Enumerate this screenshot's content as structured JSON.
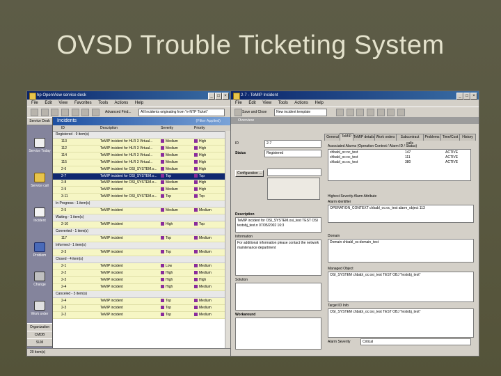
{
  "slide": {
    "title": "OVSD Trouble Ticketing System"
  },
  "left_window": {
    "title": "hp OpenView service desk",
    "menu": [
      "File",
      "Edit",
      "View",
      "Favorites",
      "Tools",
      "Actions",
      "Help"
    ],
    "advanced_find": "Advanced Find...",
    "query_combo": "All Incidents originating from \"e-NTP Ticket\"",
    "sidebar": [
      {
        "label": "Service Desk"
      },
      {
        "label": "Service Today"
      },
      {
        "label": "Service call"
      },
      {
        "label": "Incident"
      },
      {
        "label": "Problem"
      },
      {
        "label": "Change"
      },
      {
        "label": "Work order"
      }
    ],
    "sidebar_bottom": [
      "Organization",
      "CMDB",
      "SLM"
    ],
    "panel_title": "Incidents",
    "filter_label": "(Filter Applied)",
    "columns": [
      "ID",
      "Description",
      "Severity",
      "Priority"
    ],
    "rows": [
      {
        "kind": "group",
        "text": "Registered - 9 item(s)"
      },
      {
        "kind": "ticket",
        "id": "113",
        "desc": "TeMIP incident for HLR 3 Virtual...",
        "sev": "Medium",
        "pri": "High"
      },
      {
        "kind": "ticket",
        "id": "112",
        "desc": "TeMIP incident for HLR 3 Virtual...",
        "sev": "Medium",
        "pri": "High"
      },
      {
        "kind": "ticket",
        "id": "114",
        "desc": "TeMIP incident for HLR 3 Virtual...",
        "sev": "Medium",
        "pri": "High"
      },
      {
        "kind": "ticket",
        "id": "115",
        "desc": "TeMIP incident for HLR 3 Virtual...",
        "sev": "Medium",
        "pri": "High"
      },
      {
        "kind": "ticket",
        "id": "2-6",
        "desc": "TeMIP incident for OSI_SYSTEM.o...",
        "sev": "Medium",
        "pri": "High"
      },
      {
        "kind": "selected",
        "id": "2-7",
        "desc": "TeMIP incident for OSI_SYSTEM.o...",
        "sev": "Top",
        "pri": "Top"
      },
      {
        "kind": "ticket",
        "id": "2-8",
        "desc": "TeMIP incident for OSI_SYSTEM.o...",
        "sev": "Medium",
        "pri": "High"
      },
      {
        "kind": "ticket",
        "id": "2-9",
        "desc": "TeMIP incident",
        "sev": "Medium",
        "pri": "High"
      },
      {
        "kind": "ticket",
        "id": "3-11",
        "desc": "TeMIP incident for OSI_SYSTEM.o...",
        "sev": "Top",
        "pri": "Top"
      },
      {
        "kind": "group",
        "text": "In Progress - 1 item(s)"
      },
      {
        "kind": "ticket",
        "id": "2-5",
        "desc": "TeMIP incident",
        "sev": "Medium",
        "pri": "Medium"
      },
      {
        "kind": "group",
        "text": "Waiting - 1 item(s)"
      },
      {
        "kind": "ticket",
        "id": "2-10",
        "desc": "TeMIP incident",
        "sev": "High",
        "pri": "Top"
      },
      {
        "kind": "group",
        "text": "Converted - 1 item(s)"
      },
      {
        "kind": "ticket",
        "id": "117",
        "desc": "TeMIP incident",
        "sev": "Top",
        "pri": "Medium"
      },
      {
        "kind": "group",
        "text": "Informed - 1 item(s)"
      },
      {
        "kind": "ticket",
        "id": "2-3",
        "desc": "TeMIP incident",
        "sev": "Top",
        "pri": "Medium"
      },
      {
        "kind": "group",
        "text": "Closed - 4 item(s)"
      },
      {
        "kind": "ticket",
        "id": "2-1",
        "desc": "TeMIP incident",
        "sev": "Low",
        "pri": "Medium"
      },
      {
        "kind": "ticket",
        "id": "2-2",
        "desc": "TeMIP incident",
        "sev": "High",
        "pri": "Medium"
      },
      {
        "kind": "ticket",
        "id": "2-3",
        "desc": "TeMIP incident",
        "sev": "High",
        "pri": "High"
      },
      {
        "kind": "ticket",
        "id": "2-4",
        "desc": "TeMIP incident",
        "sev": "High",
        "pri": "Medium"
      },
      {
        "kind": "group",
        "text": "Canceled - 3 item(s)"
      },
      {
        "kind": "ticket",
        "id": "2-4",
        "desc": "TeMIP incident",
        "sev": "Top",
        "pri": "Medium"
      },
      {
        "kind": "ticket",
        "id": "2-3",
        "desc": "TeMIP incident",
        "sev": "Top",
        "pri": "Medium"
      },
      {
        "kind": "ticket",
        "id": "2-2",
        "desc": "TeMIP incident",
        "sev": "Top",
        "pri": "Medium"
      }
    ],
    "status": "20 item(s)"
  },
  "right_window": {
    "title": "2-7 - TeMIP Incident",
    "menu": [
      "File",
      "Edit",
      "View",
      "Tools",
      "Actions",
      "Help"
    ],
    "save_close": "Save and Close",
    "template_combo": "New incident template",
    "overview": "Overview",
    "id_label": "ID",
    "id_value": "2-7",
    "status_label": "Status",
    "status_value": "Registered",
    "configuration_button": "Configuration ...",
    "description_label": "Description",
    "description_value": "TeMIP incident for OSI_SYSTEM.osi_test TEST OSI testobj_test.n 07/05/2002 16:3",
    "information_label": "Information",
    "information_value": "For additional information please contact the network maintenance department",
    "solution_label": "Solution",
    "workaround_label": "Workaround",
    "tabs": [
      "General",
      "TeMIP",
      "TeMIP details",
      "Work orders",
      "Subcontract calls",
      "Problems",
      "Time/Cost",
      "History"
    ],
    "alarms_label": "Associated Alarms (Operation Context / Alarm ID / Status)",
    "alarms": [
      {
        "ctx": "chbabl_oc:oc_test",
        "id": "147",
        "status": "ACTIVE"
      },
      {
        "ctx": "chbabl_oc:oc_test",
        "id": "111",
        "status": "ACTIVE"
      },
      {
        "ctx": "chbabl_oc:oc_test",
        "id": "380",
        "status": "ACTIVE"
      }
    ],
    "highest_label": "Highest Severity Alarm Attribute",
    "highest_sublabel": "Alarm identifier",
    "highest_value": "OPERATION_CONTEXT chbabl_oc:oc_test alarm_object 113",
    "domain_label": "Domain",
    "domain_value": "Domain chbabl_oc:domain_test",
    "managed_label": "Managed Object",
    "managed_value": "OSI_SYSTEM chbabl_oc:osi_test TEST OBJ \"testobj_test\"",
    "target_label": "Target ID Info",
    "target_value": "OSI_SYSTEM chbabl_oc:osi_test TEST OBJ \"testobj_test\"",
    "alarm_severity_label": "Alarm Severity",
    "alarm_severity_value": "Critical"
  }
}
